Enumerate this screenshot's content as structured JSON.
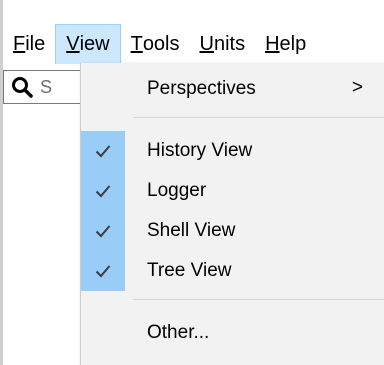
{
  "menubar": {
    "items": [
      {
        "label_u": "F",
        "label_rest": "ile"
      },
      {
        "label_u": "V",
        "label_rest": "iew"
      },
      {
        "label_u": "T",
        "label_rest": "ools"
      },
      {
        "label_u": "U",
        "label_rest": "nits"
      },
      {
        "label_u": "H",
        "label_rest": "elp"
      }
    ],
    "active_index": 1
  },
  "search": {
    "value": "S",
    "icon": "search-icon"
  },
  "view_menu": {
    "perspectives": {
      "label": "Perspectives",
      "submenu_indicator": ">"
    },
    "toggles": [
      {
        "label": "History View",
        "checked": true
      },
      {
        "label": "Logger",
        "checked": true
      },
      {
        "label": "Shell View",
        "checked": true
      },
      {
        "label": "Tree View",
        "checked": true
      }
    ],
    "other": {
      "label": "Other..."
    }
  },
  "colors": {
    "menu_active_bg": "#cce8ff",
    "check_column_bg": "#99ccf7",
    "dropdown_bg": "#f2f2f2"
  }
}
